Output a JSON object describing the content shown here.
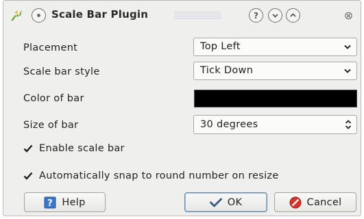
{
  "window": {
    "title": "Scale Bar Plugin",
    "icons": {
      "logo": "qgis-logo-icon",
      "menu": "window-menu-icon",
      "context_help": "context-help-icon",
      "minimize": "minimize-icon",
      "maximize": "maximize-icon",
      "close": "close-icon"
    },
    "context_help_glyph": "?",
    "close_glyph": "⊗"
  },
  "form": {
    "placement": {
      "label": "Placement",
      "value": "Top Left"
    },
    "style": {
      "label": "Scale bar style",
      "value": "Tick Down"
    },
    "color": {
      "label": "Color of bar",
      "value": "#000000"
    },
    "size": {
      "label": "Size of bar",
      "value": "30 degrees"
    }
  },
  "checks": {
    "enable": {
      "label": "Enable scale bar",
      "checked": true
    },
    "snap": {
      "label": "Automatically snap to round number on resize",
      "checked": true
    }
  },
  "buttons": {
    "help": {
      "label": "Help",
      "icon": "help-book-icon"
    },
    "ok": {
      "label": "OK",
      "icon": "checkmark-icon"
    },
    "cancel": {
      "label": "Cancel",
      "icon": "cancel-icon"
    }
  },
  "colors": {
    "accent": "#5d86b5",
    "background": "#efefed",
    "cancel_icon": "#d9332b",
    "help_icon": "#3a78c9"
  }
}
